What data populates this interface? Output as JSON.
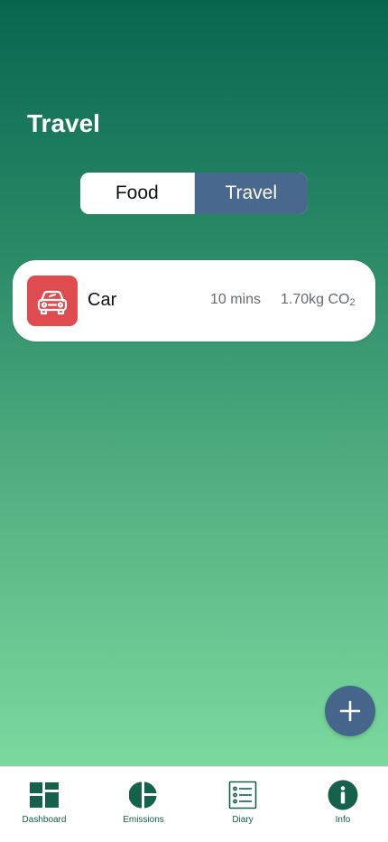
{
  "header": {
    "title": "Travel"
  },
  "segmented": {
    "options": [
      {
        "label": "Food",
        "selected": false
      },
      {
        "label": "Travel",
        "selected": true
      }
    ]
  },
  "entries": [
    {
      "label": "Car",
      "icon": "car-icon",
      "duration": "10 mins",
      "co2_value": "1.70kg CO",
      "co2_subscript": "2",
      "icon_color": "#de4c4f"
    }
  ],
  "fab": {
    "icon": "plus-icon"
  },
  "tabbar": {
    "items": [
      {
        "label": "Dashboard",
        "icon": "dashboard-icon"
      },
      {
        "label": "Emissions",
        "icon": "pie-chart-icon"
      },
      {
        "label": "Diary",
        "icon": "list-icon"
      },
      {
        "label": "Info",
        "icon": "info-icon"
      }
    ]
  },
  "colors": {
    "accent": "#48688d",
    "brand_green": "#14614c",
    "gradient_top": "#08664f",
    "gradient_bottom": "#86e5a4"
  }
}
